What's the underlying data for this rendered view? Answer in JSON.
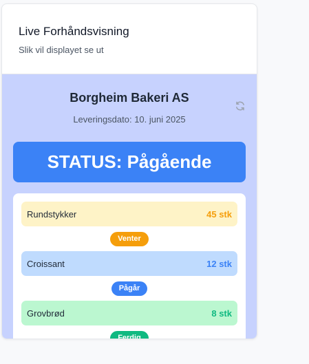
{
  "header": {
    "title": "Live Forhåndsvisning",
    "subtitle": "Slik vil displayet se ut"
  },
  "display": {
    "company": "Borgheim Bakeri AS",
    "delivery_date": "Leveringsdato: 10. juni 2025",
    "refresh_icon": "refresh-icon",
    "status": "STATUS: Pågående",
    "status_color": "#3b82f6",
    "items": [
      {
        "name": "Rundstykker",
        "quantity": "45 stk",
        "status": "Venter",
        "row_bg": "#fef3c7",
        "qty_color": "#f59e0b",
        "badge_color": "#f59e0b"
      },
      {
        "name": "Croissant",
        "quantity": "12 stk",
        "status": "Pågår",
        "row_bg": "#bfdbfe",
        "qty_color": "#3b82f6",
        "badge_color": "#3b82f6"
      },
      {
        "name": "Grovbrød",
        "quantity": "8 stk",
        "status": "Ferdig",
        "row_bg": "#bbf7d0",
        "qty_color": "#10b981",
        "badge_color": "#10b981"
      }
    ]
  }
}
